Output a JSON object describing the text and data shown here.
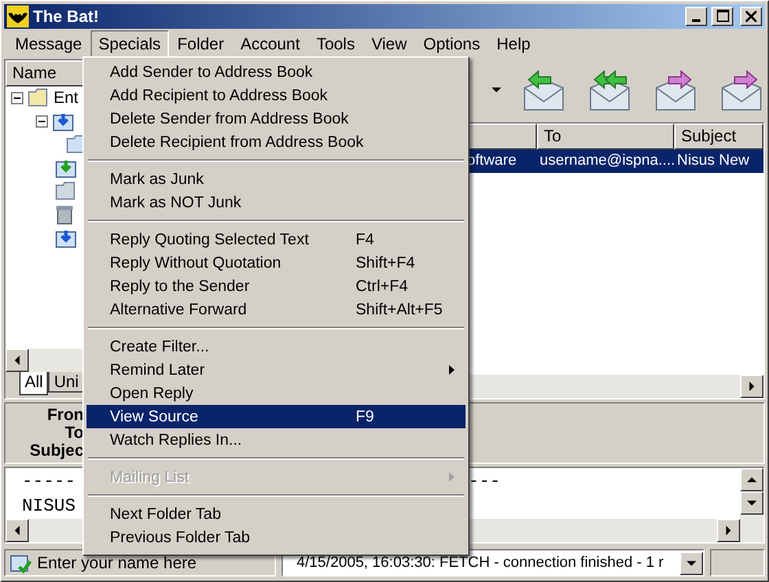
{
  "window": {
    "title": "The Bat!"
  },
  "menubar": [
    {
      "label": "Message",
      "selected": false
    },
    {
      "label": "Specials",
      "selected": true
    },
    {
      "label": "Folder",
      "selected": false
    },
    {
      "label": "Account",
      "selected": false
    },
    {
      "label": "Tools",
      "selected": false
    },
    {
      "label": "View",
      "selected": false
    },
    {
      "label": "Options",
      "selected": false
    },
    {
      "label": "Help",
      "selected": false
    }
  ],
  "folder_tree": {
    "header": "Name",
    "root": {
      "label": "Ent",
      "expanded": true
    },
    "tabs": [
      {
        "label": "All",
        "selected": true
      },
      {
        "label": "Uni",
        "selected": false
      }
    ]
  },
  "message_list": {
    "columns": [
      "To",
      "Subject"
    ],
    "rows": [
      {
        "column_1": "oftware",
        "to": "username@ispna....",
        "subject": "Nisus New",
        "selected": true
      }
    ]
  },
  "header_pane": {
    "labels": [
      "Fron",
      "To",
      "Subjec"
    ]
  },
  "message_body": {
    "lines": [
      {
        "left": "-----",
        "right": "---"
      },
      {
        "left": "NISUS"
      }
    ]
  },
  "specials_menu": [
    {
      "kind": "item",
      "label": "Add Sender to Address Book",
      "submenu": false,
      "disabled": false,
      "selected": false
    },
    {
      "kind": "item",
      "label": "Add Recipient to Address Book",
      "submenu": false,
      "disabled": false,
      "selected": false
    },
    {
      "kind": "item",
      "label": "Delete Sender from Address Book",
      "submenu": false,
      "disabled": false,
      "selected": false
    },
    {
      "kind": "item",
      "label": "Delete Recipient from Address Book",
      "submenu": false,
      "disabled": false,
      "selected": false
    },
    {
      "kind": "separator"
    },
    {
      "kind": "item",
      "label": "Mark as Junk",
      "submenu": false,
      "disabled": false,
      "selected": false
    },
    {
      "kind": "item",
      "label": "Mark as NOT Junk",
      "submenu": false,
      "disabled": false,
      "selected": false
    },
    {
      "kind": "separator"
    },
    {
      "kind": "item",
      "label": "Reply Quoting Selected Text",
      "shortcut": "F4",
      "submenu": false,
      "disabled": false,
      "selected": false
    },
    {
      "kind": "item",
      "label": "Reply Without Quotation",
      "shortcut": "Shift+F4",
      "submenu": false,
      "disabled": false,
      "selected": false
    },
    {
      "kind": "item",
      "label": "Reply to the Sender",
      "shortcut": "Ctrl+F4",
      "submenu": false,
      "disabled": false,
      "selected": false
    },
    {
      "kind": "item",
      "label": "Alternative Forward",
      "shortcut": "Shift+Alt+F5",
      "submenu": false,
      "disabled": false,
      "selected": false
    },
    {
      "kind": "separator"
    },
    {
      "kind": "item",
      "label": "Create Filter...",
      "submenu": false,
      "disabled": false,
      "selected": false
    },
    {
      "kind": "item",
      "label": "Remind Later",
      "submenu": true,
      "disabled": false,
      "selected": false
    },
    {
      "kind": "item",
      "label": "Open Reply",
      "submenu": false,
      "disabled": false,
      "selected": false
    },
    {
      "kind": "item",
      "label": "View Source",
      "shortcut": "F9",
      "submenu": false,
      "disabled": false,
      "selected": true
    },
    {
      "kind": "item",
      "label": "Watch Replies In...",
      "submenu": false,
      "disabled": false,
      "selected": false
    },
    {
      "kind": "separator"
    },
    {
      "kind": "item",
      "label": "Mailing List",
      "submenu": true,
      "disabled": true,
      "selected": false
    },
    {
      "kind": "separator"
    },
    {
      "kind": "item",
      "label": "Next Folder Tab",
      "submenu": false,
      "disabled": false,
      "selected": false
    },
    {
      "kind": "item",
      "label": "Previous Folder Tab",
      "submenu": false,
      "disabled": false,
      "selected": false
    }
  ],
  "status_bar": {
    "name_placeholder": "Enter your name here",
    "log": "4/15/2005, 16:03:30: FETCH - connection finished - 1 r"
  }
}
